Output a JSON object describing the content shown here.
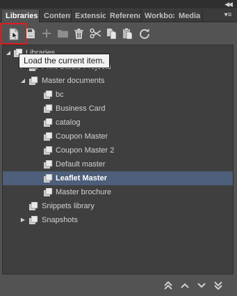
{
  "panel": {
    "collapse_glyph": "◀◀",
    "menu_glyph": "▾≡"
  },
  "tabs": [
    {
      "label": "Libraries",
      "active": true
    },
    {
      "label": "Content",
      "active": false
    },
    {
      "label": "Extension",
      "active": false
    },
    {
      "label": "Reference",
      "active": false
    },
    {
      "label": "Workbox",
      "active": false
    },
    {
      "label": "Media",
      "active": false
    }
  ],
  "toolbar": {
    "buttons": [
      {
        "icon": "load-item-icon",
        "highlighted": true
      },
      {
        "icon": "save-icon",
        "highlighted": false
      },
      {
        "icon": "add-icon",
        "highlighted": false
      },
      {
        "icon": "folder-icon",
        "highlighted": false
      },
      {
        "icon": "trash-icon",
        "highlighted": false
      },
      {
        "icon": "cut-icon",
        "highlighted": false
      },
      {
        "icon": "copy-icon",
        "highlighted": false
      },
      {
        "icon": "paste-icon",
        "highlighted": false
      },
      {
        "icon": "refresh-icon",
        "highlighted": false
      }
    ],
    "accent_color": "#e31b1b"
  },
  "tooltip": {
    "text": "Load the current item."
  },
  "tree": {
    "selected_color": "#4d5f7a",
    "items": [
      {
        "label": "Libraries",
        "level": 0,
        "toggle": "expanded",
        "icon": "library-icon"
      },
      {
        "label": "Print Studio Projects",
        "level": 1,
        "toggle": "collapsed",
        "icon": "folder-stack-icon"
      },
      {
        "label": "Master documents",
        "level": 1,
        "toggle": "expanded",
        "icon": "folder-stack-icon"
      },
      {
        "label": "bc",
        "level": 2,
        "toggle": "none",
        "icon": "document-icon"
      },
      {
        "label": "Business Card",
        "level": 2,
        "toggle": "none",
        "icon": "document-icon"
      },
      {
        "label": "catalog",
        "level": 2,
        "toggle": "none",
        "icon": "document-icon"
      },
      {
        "label": "Coupon Master",
        "level": 2,
        "toggle": "none",
        "icon": "document-icon"
      },
      {
        "label": "Coupon Master 2",
        "level": 2,
        "toggle": "none",
        "icon": "document-icon"
      },
      {
        "label": "Default master",
        "level": 2,
        "toggle": "none",
        "icon": "document-icon"
      },
      {
        "label": "Leaflet Master",
        "level": 2,
        "toggle": "none",
        "icon": "document-icon",
        "selected": true
      },
      {
        "label": "Master brochure",
        "level": 2,
        "toggle": "none",
        "icon": "document-icon"
      },
      {
        "label": "Snippets library",
        "level": 1,
        "toggle": "none",
        "icon": "folder-stack-icon"
      },
      {
        "label": "Snapshots",
        "level": 1,
        "toggle": "collapsed",
        "icon": "folder-stack-icon"
      }
    ]
  },
  "bottom_nav": {
    "buttons": [
      {
        "icon": "move-top-icon"
      },
      {
        "icon": "move-up-icon"
      },
      {
        "icon": "move-down-icon"
      },
      {
        "icon": "move-bottom-icon"
      }
    ]
  }
}
